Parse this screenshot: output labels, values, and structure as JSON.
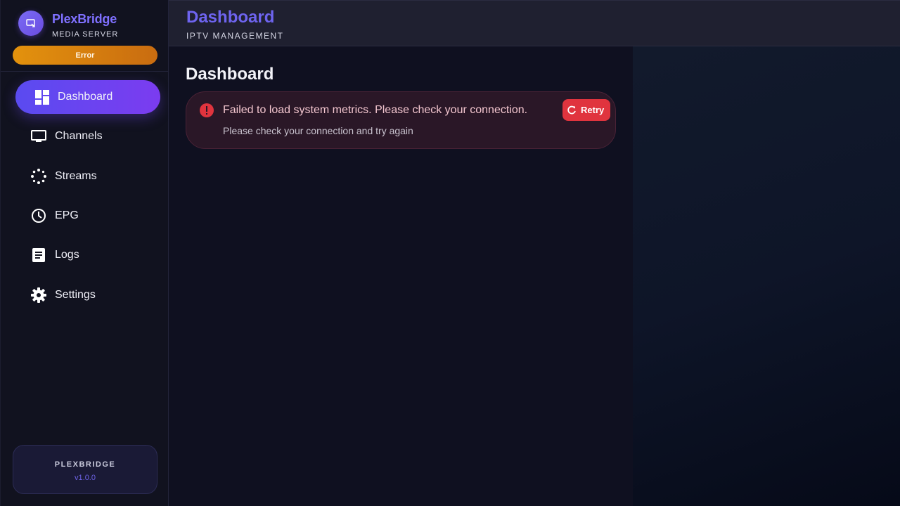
{
  "sidebar": {
    "brand": {
      "name": "PlexBridge",
      "subtitle": "MEDIA SERVER",
      "logo_icon": "cast-icon"
    },
    "status_pill": {
      "label": "Error",
      "color": "#e3920d"
    },
    "items": [
      {
        "label": "Dashboard",
        "icon": "dashboard-icon",
        "active": true
      },
      {
        "label": "Channels",
        "icon": "tv-icon",
        "active": false
      },
      {
        "label": "Streams",
        "icon": "streams-icon",
        "active": false
      },
      {
        "label": "EPG",
        "icon": "clock-icon",
        "active": false
      },
      {
        "label": "Logs",
        "icon": "document-icon",
        "active": false
      },
      {
        "label": "Settings",
        "icon": "gear-icon",
        "active": false
      }
    ],
    "version_card": {
      "title": "PLEXBRIDGE",
      "version": "v1.0.0"
    }
  },
  "header": {
    "title": "Dashboard",
    "subtitle": "IPTV MANAGEMENT"
  },
  "main": {
    "page_title": "Dashboard",
    "alert": {
      "severity": "error",
      "icon": "error-icon",
      "message": "Failed to load system metrics. Please check your connection.",
      "detail": "Please check your connection and try again",
      "retry_label": "Retry",
      "retry_icon": "refresh-icon"
    }
  },
  "colors": {
    "accent": "#6e64ef",
    "active_nav_gradient": [
      "#5a4bf0",
      "#7b3cf0"
    ],
    "error": "#e0343e",
    "warning": "#e3920d"
  }
}
